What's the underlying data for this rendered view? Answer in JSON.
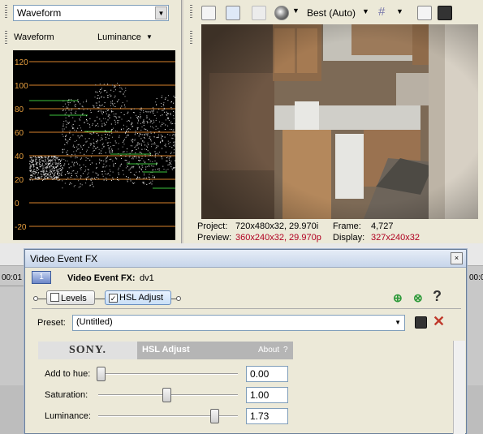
{
  "scope_panel": {
    "select_value": "Waveform",
    "title": "Waveform",
    "mode": "Luminance",
    "scale_labels": [
      "120",
      "100",
      "80",
      "60",
      "40",
      "20",
      "0",
      "-20"
    ]
  },
  "preview_panel": {
    "quality": "Best (Auto)",
    "info": {
      "project_label": "Project:",
      "project_value": "720x480x32, 29.970i",
      "preview_label": "Preview:",
      "preview_value": "360x240x32, 29.970p",
      "frame_label": "Frame:",
      "frame_value": "4,727",
      "display_label": "Display:",
      "display_value": "327x240x32"
    }
  },
  "timeline": {
    "left_time": "00:01",
    "right_time": "00:0"
  },
  "dialog": {
    "title": "Video Event FX",
    "close_glyph": "×",
    "track_number": "1",
    "fx_label": "Video Event FX:",
    "fx_target": "dv1",
    "chain": [
      {
        "label": "Levels",
        "checked": false
      },
      {
        "label": "HSL Adjust",
        "checked": true
      }
    ],
    "help_glyph": "?",
    "preset_label": "Preset:",
    "preset_value": "(Untitled)",
    "brand": "SONY.",
    "plugin_name": "HSL Adjust",
    "about_label": "About",
    "about_help": "?",
    "params": [
      {
        "label": "Add to hue:",
        "value": "0.00",
        "position": 0.0
      },
      {
        "label": "Saturation:",
        "value": "1.00",
        "position": 0.5
      },
      {
        "label": "Luminance:",
        "value": "1.73",
        "position": 0.865
      }
    ]
  },
  "colors": {
    "scope_grid": "#d9822b",
    "scope_label": "#e8a040",
    "scope_marker": "#3cc23c",
    "red_text": "#b00020",
    "delete_icon": "#c0392b",
    "add_icon": "#2e9a3a"
  }
}
